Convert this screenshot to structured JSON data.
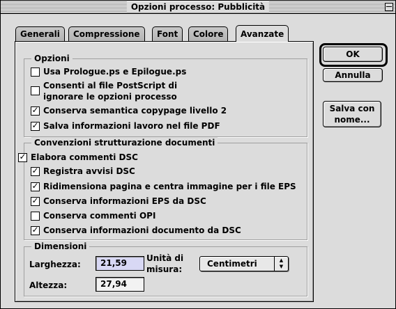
{
  "window": {
    "title": "Opzioni processo: Pubblicità"
  },
  "tabs": [
    {
      "label": "Generali",
      "active": false
    },
    {
      "label": "Compressione",
      "active": false
    },
    {
      "label": "Font",
      "active": false
    },
    {
      "label": "Colore",
      "active": false
    },
    {
      "label": "Avanzate",
      "active": true
    }
  ],
  "options": {
    "title": "Opzioni",
    "items": [
      {
        "label": "Usa Prologue.ps e Epilogue.ps",
        "checked": false
      },
      {
        "label": "Consenti al file PostScript di",
        "label2": "ignorare le opzioni processo",
        "checked": false
      },
      {
        "label": "Conserva semantica copypage livello 2",
        "checked": true
      },
      {
        "label": "Salva informazioni lavoro nel file PDF",
        "checked": true
      }
    ]
  },
  "dsc": {
    "title": "Convenzioni strutturazione documenti",
    "items": [
      {
        "label": "Elabora commenti DSC",
        "checked": true
      },
      {
        "label": "Registra avvisi DSC",
        "checked": true
      },
      {
        "label": "Ridimensiona pagina e centra immagine per i file EPS",
        "checked": true
      },
      {
        "label": "Conserva informazioni EPS da DSC",
        "checked": true
      },
      {
        "label": "Conserva commenti OPI",
        "checked": false
      },
      {
        "label": "Conserva informazioni documento da DSC",
        "checked": true
      }
    ]
  },
  "dimensions": {
    "title": "Dimensioni",
    "width_label": "Larghezza:",
    "width_value": "21,59",
    "height_label": "Altezza:",
    "height_value": "27,94",
    "unit_label_1": "Unità di",
    "unit_label_2": "misura:",
    "unit_value": "Centimetri"
  },
  "buttons": {
    "ok": "OK",
    "cancel": "Annulla",
    "save_line1": "Salva con",
    "save_line2": "nome..."
  },
  "check_glyph": "✓"
}
